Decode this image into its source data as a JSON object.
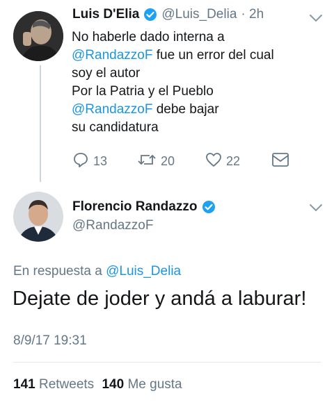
{
  "tweet1": {
    "name": "Luis D'Elia",
    "handle": "@Luis_Delia",
    "time": "· 2h",
    "lines": [
      {
        "pre": "No haberle dado interna a",
        "mention": ""
      },
      {
        "pre": "",
        "mention": "@RandazzoF",
        "post": " fue un error del cual"
      },
      {
        "pre": "soy el autor",
        "mention": ""
      },
      {
        "pre": "Por la Patria y el Pueblo",
        "mention": ""
      },
      {
        "pre": "",
        "mention": "@RandazzoF",
        "post": " debe bajar"
      },
      {
        "pre": "su candidatura",
        "mention": ""
      }
    ],
    "replies": "13",
    "retweets": "20",
    "likes": "22"
  },
  "tweet2": {
    "name": "Florencio Randazzo",
    "handle": "@RandazzoF",
    "reply_prefix": "En respuesta a ",
    "reply_to": "@Luis_Delia",
    "text": "Dejate de joder y andá a laburar!",
    "timestamp": "8/9/17 19:31",
    "retweets_count": "141",
    "retweets_label": " Retweets",
    "likes_count": "140",
    "likes_label": " Me gusta"
  },
  "colors": {
    "accent": "#1b95e0",
    "muted": "#657786",
    "verified": "#1da1f2"
  }
}
